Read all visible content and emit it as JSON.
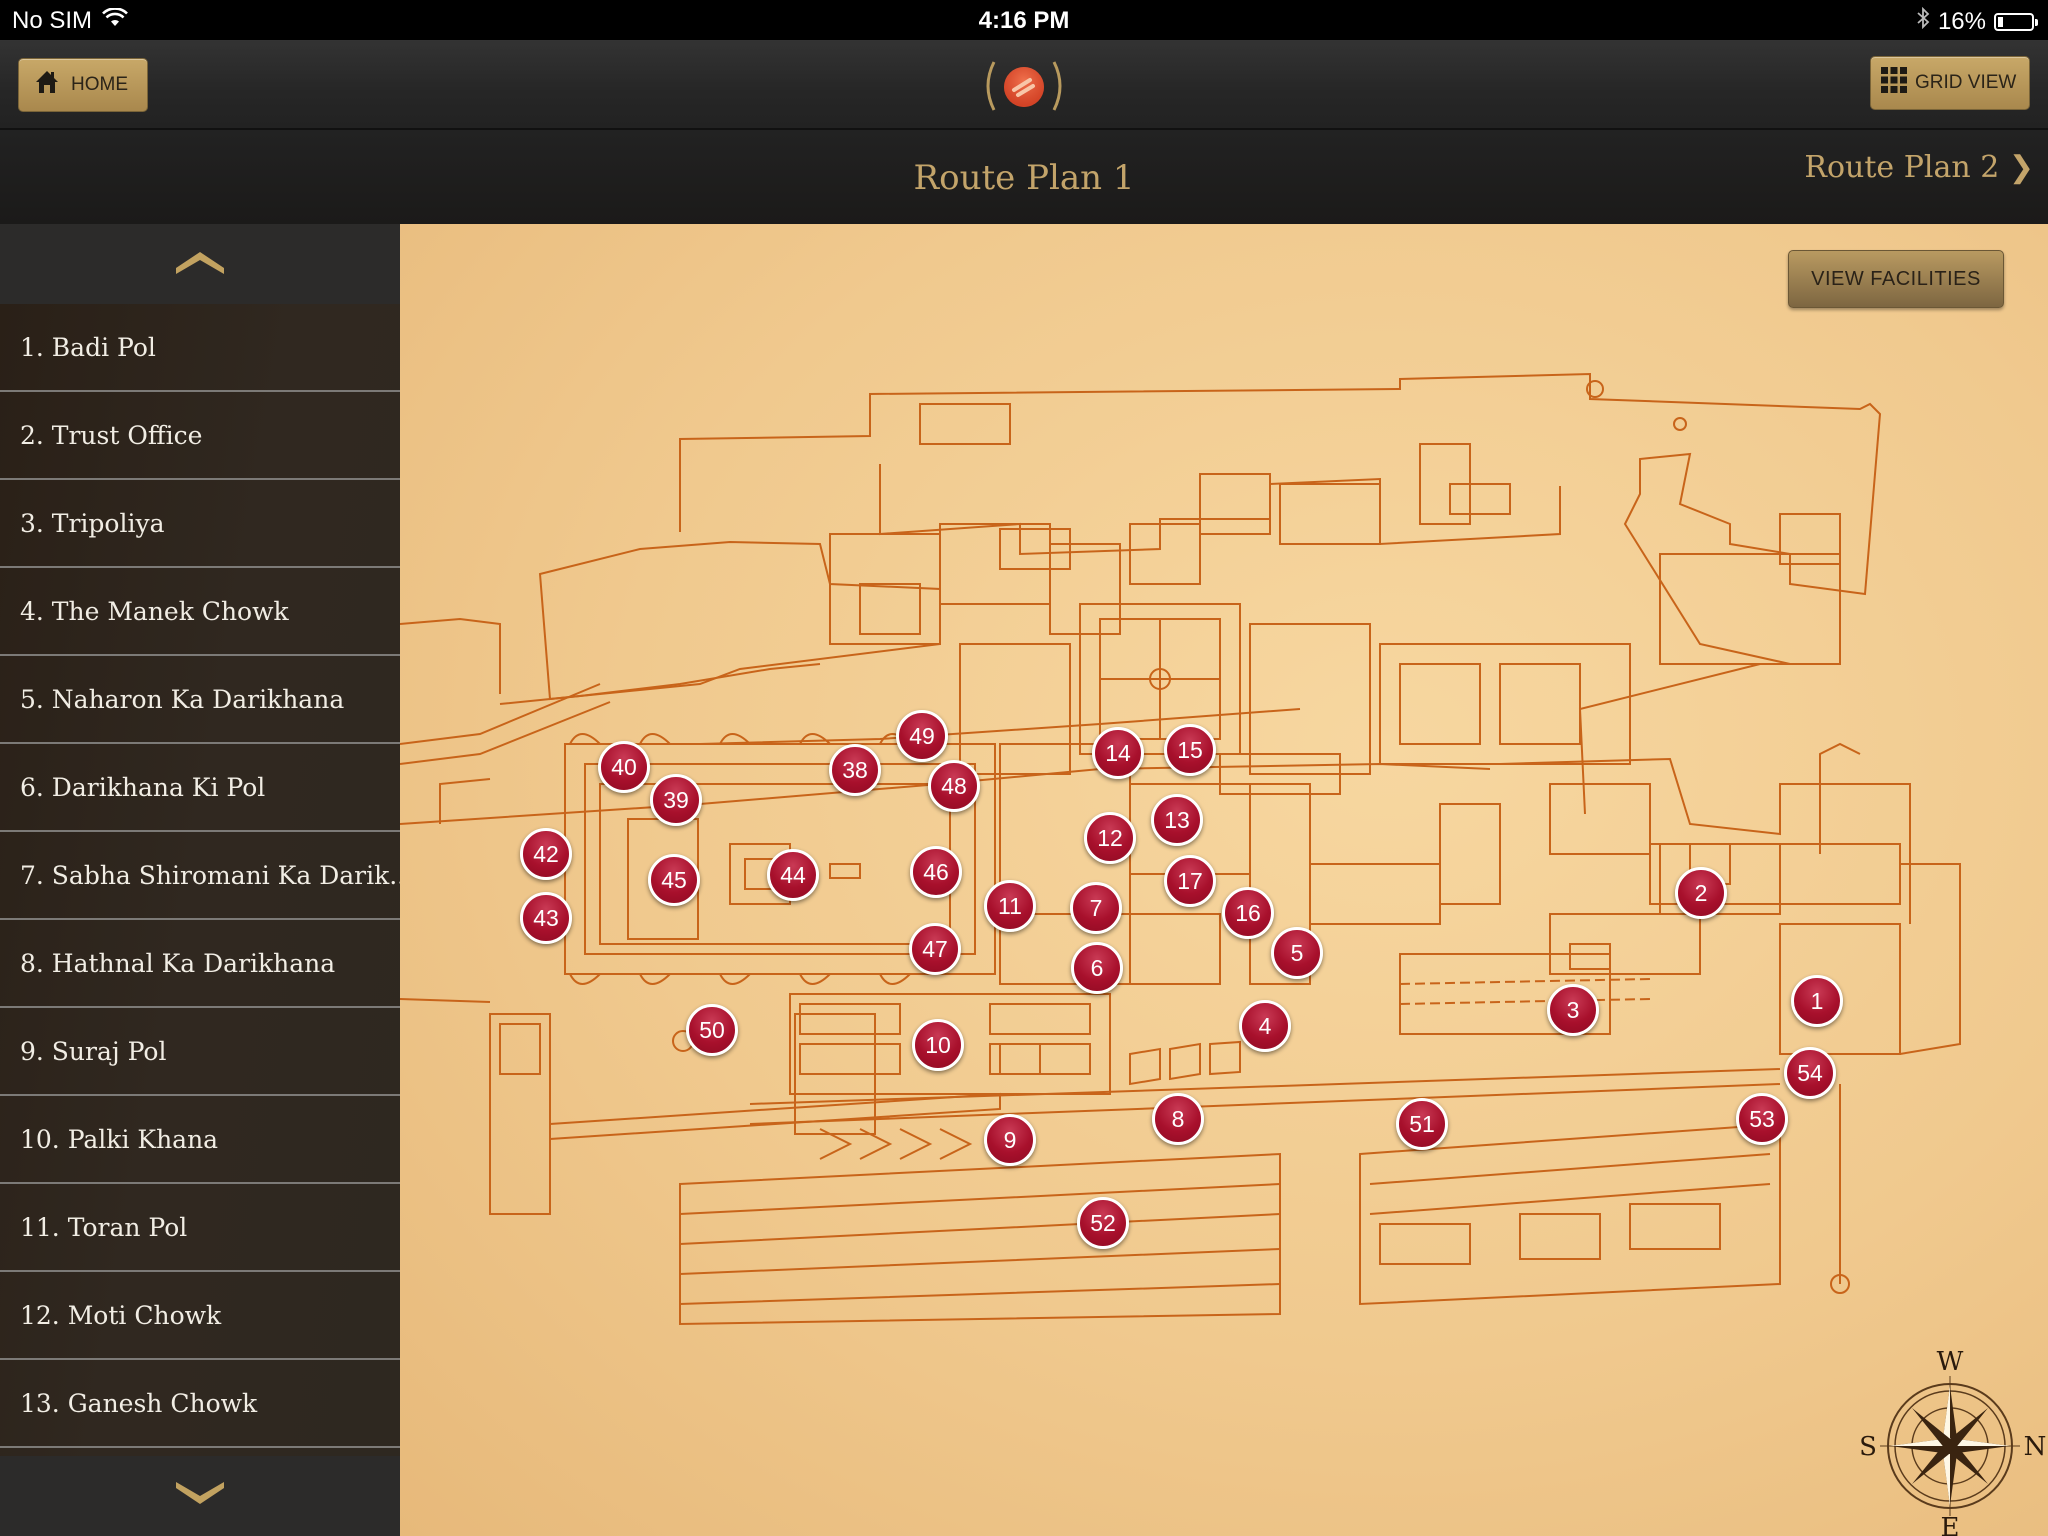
{
  "status_bar": {
    "carrier": "No SIM",
    "time": "4:16 PM",
    "battery_percent_text": "16%",
    "battery_level": 0.16,
    "icons": [
      "wifi-icon",
      "bluetooth-icon",
      "battery-icon"
    ]
  },
  "nav": {
    "home_label": "HOME",
    "grid_view_label": "GRID VIEW",
    "logo": "app-logo"
  },
  "route": {
    "title": "Route Plan 1",
    "next_label": "Route Plan 2 ❯"
  },
  "sidebar": {
    "items": [
      {
        "label": "1. Badi Pol"
      },
      {
        "label": "2. Trust Office"
      },
      {
        "label": "3. Tripoliya"
      },
      {
        "label": "4. The Manek Chowk"
      },
      {
        "label": "5. Naharon Ka Darikhana"
      },
      {
        "label": "6. Darikhana Ki Pol"
      },
      {
        "label": "7. Sabha Shiromani Ka Darik..."
      },
      {
        "label": "8. Hathnal Ka Darikhana"
      },
      {
        "label": "9. Suraj Pol"
      },
      {
        "label": "10. Palki Khana"
      },
      {
        "label": "11. Toran Pol"
      },
      {
        "label": "12. Moti Chowk"
      },
      {
        "label": "13. Ganesh Chowk"
      }
    ]
  },
  "map": {
    "view_facilities_label": "VIEW FACILITIES",
    "markers": [
      "1",
      "2",
      "3",
      "4",
      "5",
      "6",
      "7",
      "8",
      "9",
      "10",
      "11",
      "12",
      "13",
      "14",
      "15",
      "16",
      "17",
      "38",
      "39",
      "40",
      "42",
      "43",
      "44",
      "45",
      "46",
      "47",
      "48",
      "49",
      "50",
      "51",
      "52",
      "53",
      "54"
    ],
    "compass": {
      "top": "W",
      "left": "S",
      "right": "N",
      "bottom": "E"
    }
  },
  "colors": {
    "gold_accent": "#c3a46a",
    "marker_red": "#a8102c",
    "parchment": "#f0c98e",
    "plan_line": "#c8641a"
  }
}
